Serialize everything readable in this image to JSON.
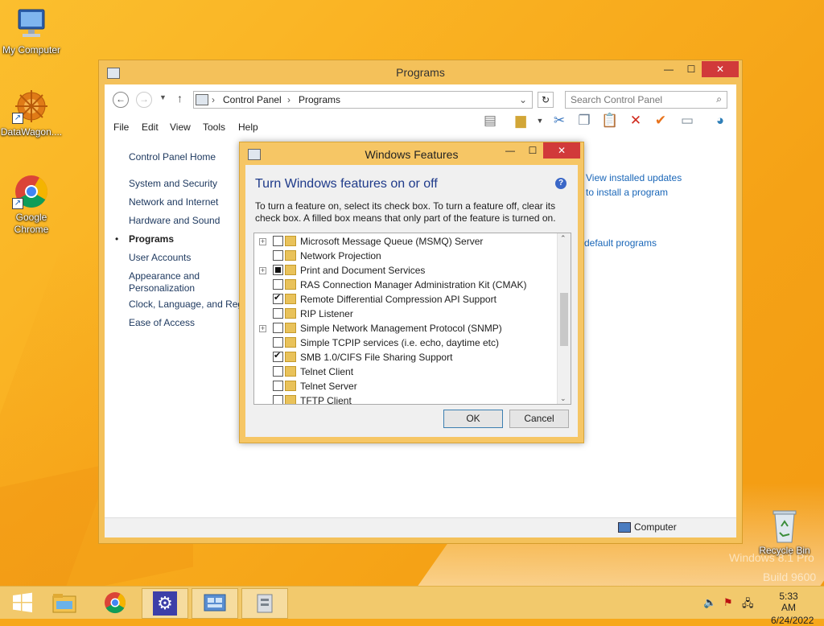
{
  "desktop": {
    "icons": [
      {
        "label": "My Computer"
      },
      {
        "label": "DataWagon...."
      },
      {
        "label": "Google Chrome"
      },
      {
        "label": "Recycle Bin"
      }
    ],
    "watermark_edition": "Windows 8.1 Pro",
    "watermark_build": "Build 9600"
  },
  "control_panel": {
    "title": "Programs",
    "breadcrumb": [
      "Control Panel",
      "Programs"
    ],
    "search_placeholder": "Search Control Panel",
    "menu": [
      "File",
      "Edit",
      "View",
      "Tools",
      "Help"
    ],
    "sidebar": [
      {
        "label": "Control Panel Home"
      },
      {
        "label": "System and Security"
      },
      {
        "label": "Network and Internet"
      },
      {
        "label": "Hardware and Sound"
      },
      {
        "label": "Programs"
      },
      {
        "label": "User Accounts"
      },
      {
        "label": "Appearance and"
      },
      {
        "label": "Personalization"
      },
      {
        "label": "Clock, Language, and Reg"
      },
      {
        "label": "Ease of Access"
      }
    ],
    "links": {
      "view_updates": "View installed updates",
      "install_program": "to install a program",
      "default_programs": "default programs"
    },
    "status": "Computer"
  },
  "windows_features": {
    "title": "Windows Features",
    "heading": "Turn Windows features on or off",
    "description": "To turn a feature on, select its check box. To turn a feature off, clear its check box. A filled box means that only part of the feature is turned on.",
    "features": [
      {
        "label": "Microsoft Message Queue (MSMQ) Server",
        "state": "unchecked",
        "expandable": true
      },
      {
        "label": "Network Projection",
        "state": "unchecked",
        "expandable": false
      },
      {
        "label": "Print and Document Services",
        "state": "partial",
        "expandable": true
      },
      {
        "label": "RAS Connection Manager Administration Kit (CMAK)",
        "state": "unchecked",
        "expandable": false
      },
      {
        "label": "Remote Differential Compression API Support",
        "state": "checked",
        "expandable": false
      },
      {
        "label": "RIP Listener",
        "state": "unchecked",
        "expandable": false
      },
      {
        "label": "Simple Network Management Protocol (SNMP)",
        "state": "unchecked",
        "expandable": true
      },
      {
        "label": "Simple TCPIP services (i.e. echo, daytime etc)",
        "state": "unchecked",
        "expandable": false
      },
      {
        "label": "SMB 1.0/CIFS File Sharing Support",
        "state": "checked",
        "expandable": false
      },
      {
        "label": "Telnet Client",
        "state": "unchecked",
        "expandable": false
      },
      {
        "label": "Telnet Server",
        "state": "unchecked",
        "expandable": false
      },
      {
        "label": "TFTP Client",
        "state": "unchecked",
        "expandable": false
      }
    ],
    "ok_label": "OK",
    "cancel_label": "Cancel"
  },
  "taskbar": {
    "time": "5:33 AM",
    "date": "6/24/2022"
  }
}
